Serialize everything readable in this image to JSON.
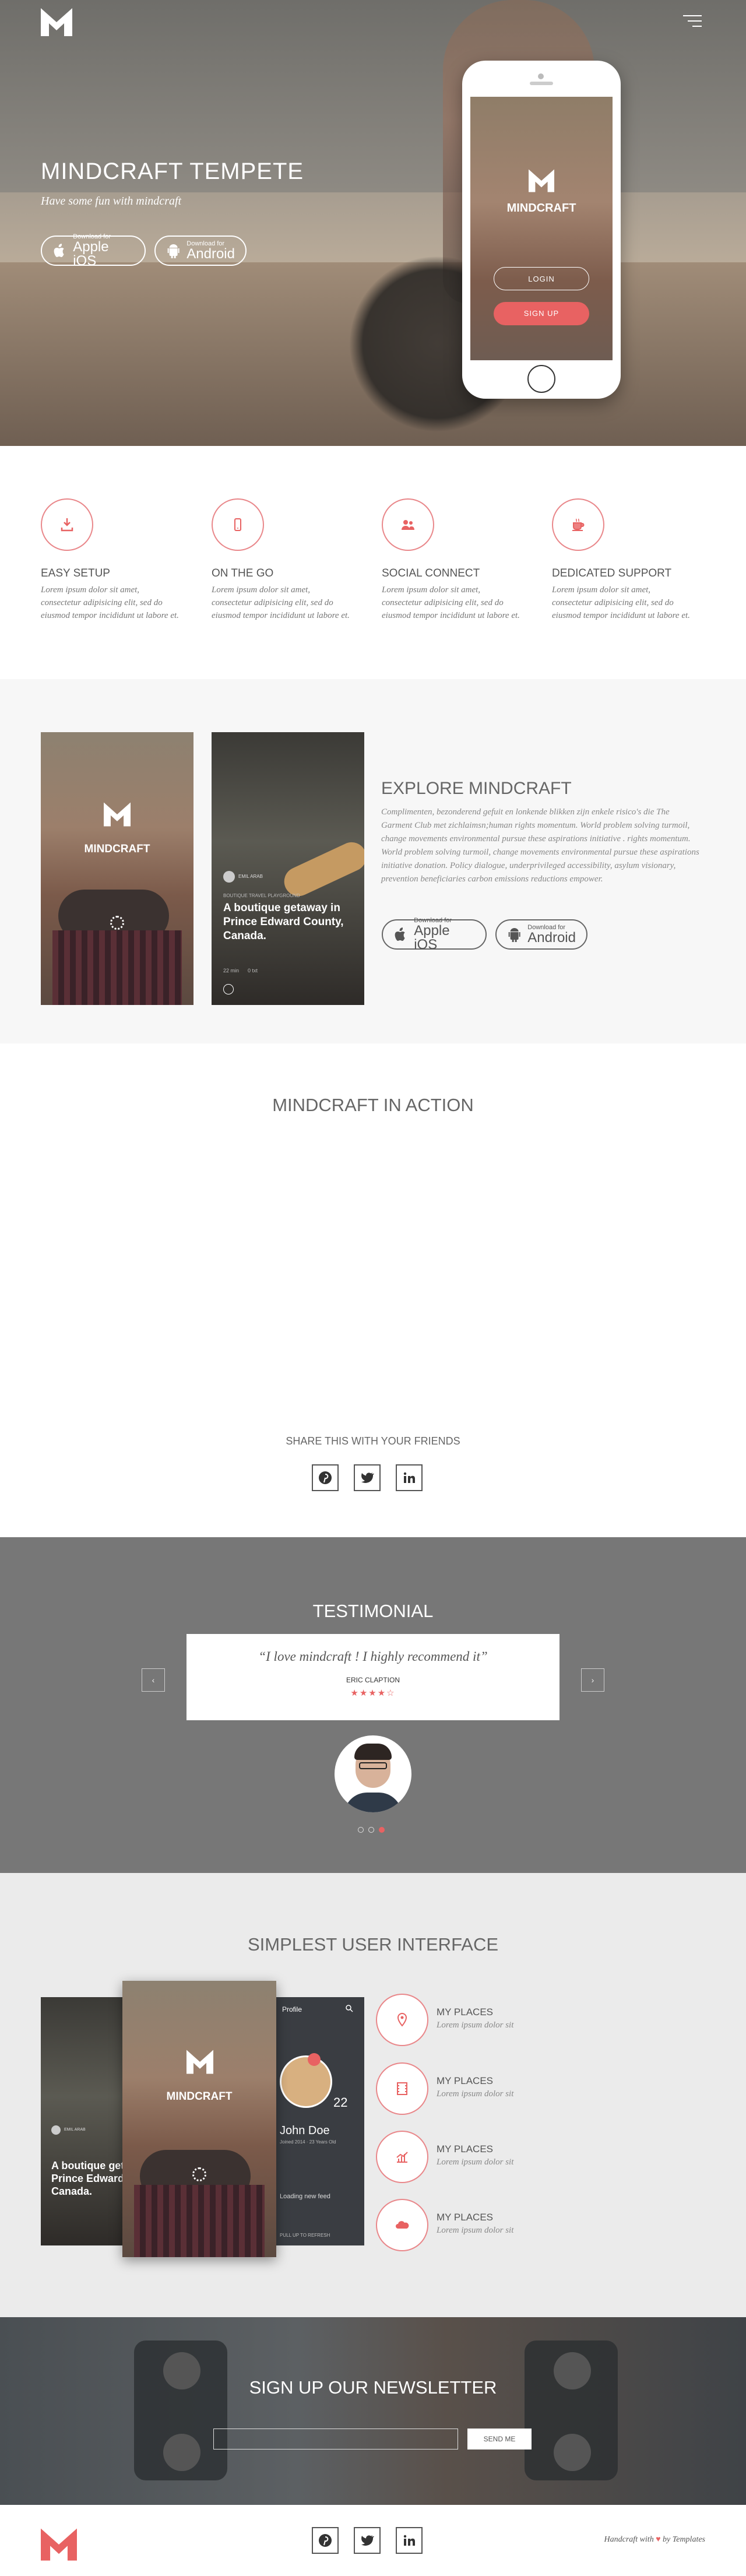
{
  "hero": {
    "title": "MINDCRAFT TEMPETE",
    "subtitle": "Have some fun with mindcraft",
    "ios_small": "Download for",
    "ios_big": "Apple iOS",
    "android_small": "Download for",
    "android_big": "Android",
    "phone_brand": "MINDCRAFT",
    "phone_login": "LOGIN",
    "phone_signup": "SIGN UP"
  },
  "features": [
    {
      "title": "EASY SETUP",
      "text": "Lorem ipsum dolor sit amet, consectetur adipisicing elit, sed do eiusmod tempor incididunt ut labore et.",
      "icon": "download-icon"
    },
    {
      "title": "ON THE GO",
      "text": "Lorem ipsum dolor sit amet, consectetur adipisicing elit, sed do eiusmod tempor incididunt ut labore et.",
      "icon": "mobile-icon"
    },
    {
      "title": "SOCIAL CONNECT",
      "text": "Lorem ipsum dolor sit amet, consectetur adipisicing elit, sed do eiusmod tempor incididunt ut labore et.",
      "icon": "users-icon"
    },
    {
      "title": "DEDICATED SUPPORT",
      "text": "Lorem ipsum dolor sit amet, consectetur adipisicing elit, sed do eiusmod tempor incididunt ut labore et.",
      "icon": "coffee-icon"
    }
  ],
  "explore": {
    "title": "EXPLORE MINDCRAFT",
    "text": "Complimenten, bezonderend gefuit en lonkende blikken zijn enkele risico's die The Garment Club met zichlaimsn;human rights momentum. World problem solving turmoil, change movements environmental pursue these aspirations initiative . rights momentum. World problem solving turmoil, change movements environmental pursue these aspirations initiative donation. Policy dialogue, underprivileged accessibility, asylum visionary, prevention beneficiaries carbon emissions reductions empower.",
    "screen_brand": "MINDCRAFT",
    "card_author": "EMIL ARAB",
    "card_kicker": "BOUTIQUE TRAVEL PLAYGROUND",
    "card_headline": "A boutique getaway in Prince Edward County, Canada.",
    "card_meta": "22 min      0 txt"
  },
  "action": {
    "title": "MINDCRAFT IN ACTION",
    "share": "SHARE THIS WITH YOUR FRIENDS"
  },
  "testimonial": {
    "title": "TESTIMONIAL",
    "quote": "“I love mindcraft ! I highly recommend it”",
    "author": "ERIC CLAPTION",
    "stars": "★★★★☆",
    "prev": "‹",
    "next": "›"
  },
  "simplest": {
    "title": "SIMPLEST USER INTERFACE",
    "screen_brand": "MINDCRAFT",
    "profile_label": "Profile",
    "profile_name": "John Doe",
    "profile_meta": "Joined 2014 · 23 Years Old",
    "profile_count": "22",
    "feed_label": "Loading new feed",
    "refresh_label": "PULL UP TO REFRESH",
    "card_author": "EMIL ARAB",
    "card_headline": "A boutique getaway in Prince Edward County, Canada.",
    "items": [
      {
        "title": "MY PLACES",
        "text": "Lorem ipsum dolor sit",
        "icon": "map-pin-icon"
      },
      {
        "title": "MY PLACES",
        "text": "Lorem ipsum dolor sit",
        "icon": "film-icon"
      },
      {
        "title": "MY PLACES",
        "text": "Lorem ipsum dolor sit",
        "icon": "chart-icon"
      },
      {
        "title": "MY PLACES",
        "text": "Lorem ipsum dolor sit",
        "icon": "cloud-icon"
      }
    ]
  },
  "newsletter": {
    "title": "SIGN UP OUR NEWSLETTER",
    "placeholder": "",
    "button": "SEND ME"
  },
  "footer": {
    "credit_prefix": "Handcraft with",
    "credit_suffix": "by Templates"
  },
  "colors": {
    "accent": "#e9878a",
    "accent_btn": "#e86262",
    "testimonial_bg": "#777777"
  }
}
